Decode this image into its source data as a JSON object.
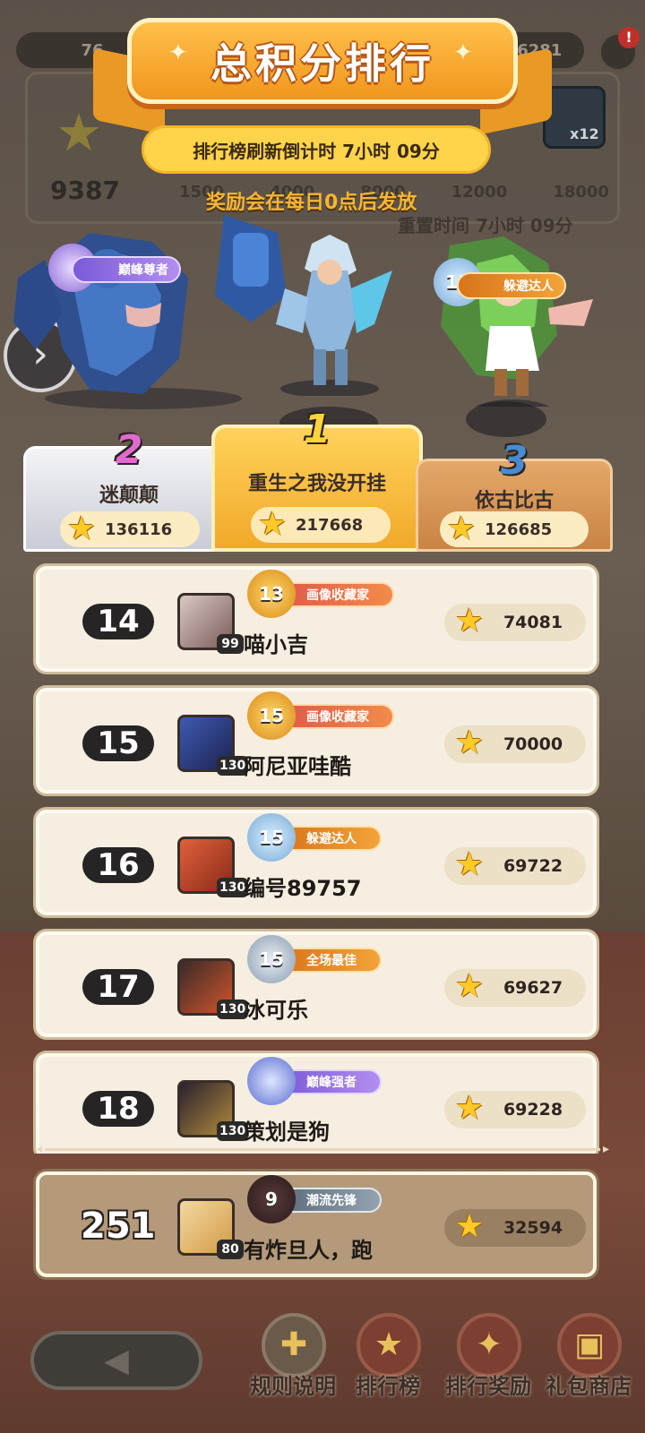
{
  "hud": {
    "left_resource": "76",
    "right_resource": "16281",
    "notice_badge": "!",
    "total_score": "9387",
    "milestones": [
      "1500",
      "4000",
      "8000",
      "12000",
      "18000"
    ],
    "reset_text": "重置时间 7小时 09分",
    "chest_count": "x12"
  },
  "banner": {
    "title": "总积分排行",
    "refresh_countdown": "排行榜刷新倒计时 7小时 09分",
    "reward_note": "奖励会在每日0点后发放"
  },
  "top_titles": {
    "rank2_title": "巅峰尊者",
    "rank3_title": "躲避达人",
    "rank3_level": "15"
  },
  "podium": [
    {
      "rank": "2",
      "name": "迷颠颠",
      "score": "136116"
    },
    {
      "rank": "1",
      "name": "重生之我没开挂",
      "score": "217668"
    },
    {
      "rank": "3",
      "name": "依古比古",
      "score": "126685"
    }
  ],
  "rows": [
    {
      "rank": "14",
      "name": "喵小吉",
      "level": "99",
      "badge_level": "13",
      "title": "画像收藏家",
      "score": "74081"
    },
    {
      "rank": "15",
      "name": "阿尼亚哇酷",
      "level": "130",
      "badge_level": "15",
      "title": "画像收藏家",
      "score": "70000"
    },
    {
      "rank": "16",
      "name": "编号89757",
      "level": "130",
      "badge_level": "15",
      "title": "躲避达人",
      "score": "69722"
    },
    {
      "rank": "17",
      "name": "冰可乐",
      "level": "130",
      "badge_level": "15",
      "title": "全场最佳",
      "score": "69627"
    },
    {
      "rank": "18",
      "name": "策划是狗",
      "level": "130",
      "badge_level": "",
      "title": "巅峰强者",
      "score": "69228"
    }
  ],
  "me": {
    "rank": "251",
    "name": "有炸旦人，跑",
    "level": "80",
    "badge_level": "9",
    "title": "潮流先锋",
    "score": "32594"
  },
  "nav": {
    "rules": "规则说明",
    "leaderboard": "排行榜",
    "rewards": "排行奖励",
    "shop": "礼包商店"
  },
  "colors": {
    "accent": "#f0961d",
    "gold": "#ffc928",
    "row_bg": "#f6eee0",
    "tag_purple": "#7a5ad9",
    "tag_orange": "#d9741a",
    "tag_red": "#e0584a",
    "tag_gray": "#5b6b7a"
  },
  "icons": [
    "gear-icon",
    "star-icon",
    "chest-icon",
    "arrow-right-icon",
    "back-arrow-icon",
    "sparkle-icon"
  ]
}
